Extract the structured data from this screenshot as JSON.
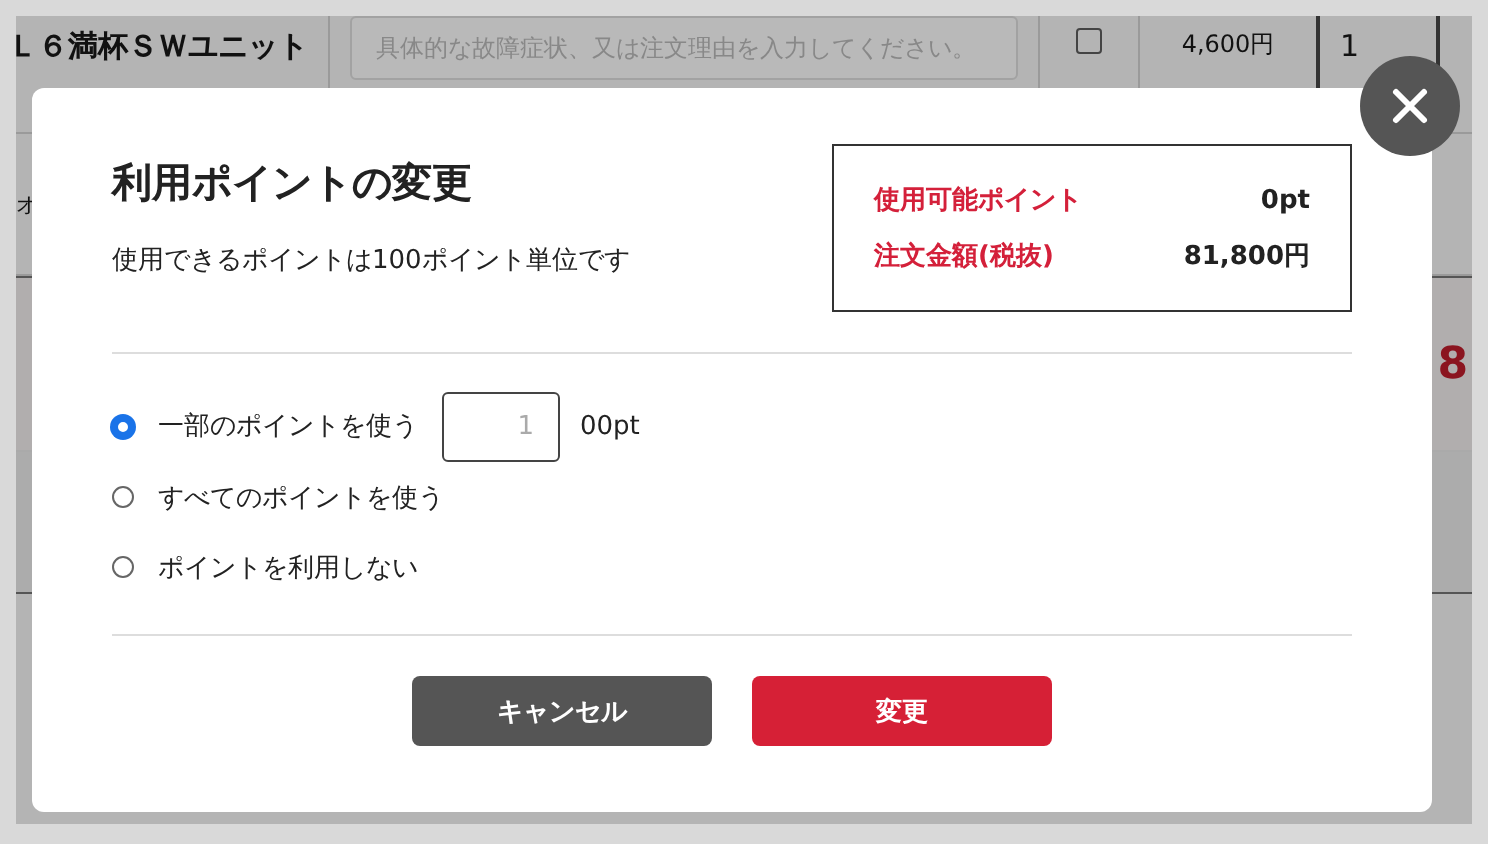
{
  "background_table": {
    "rows": [
      {
        "product": "Ｌ６満杯ＳＷユニット",
        "remark": {
          "placeholder": "具体的な故障症状、又は注文理由を入力してください。"
        },
        "checked": false,
        "price": "4,600円",
        "quantity": "1"
      }
    ],
    "row_fragment": "オ",
    "total_fragment": "8"
  },
  "dialog": {
    "title": "利用ポイントの変更",
    "note": "使用できるポイントは100ポイント単位です",
    "summary": [
      {
        "label": "使用可能ポイント",
        "value": "0pt"
      },
      {
        "label": "注文金額(税抜)",
        "value": "81,800円"
      }
    ],
    "options": [
      {
        "kind": "amount",
        "label": "一部のポイントを使う",
        "selected": true,
        "input": {
          "placeholder": "1"
        },
        "unit": "00pt"
      },
      {
        "kind": "plain",
        "label": "すべてのポイントを使う",
        "selected": false
      },
      {
        "kind": "plain",
        "label": "ポイントを利用しない",
        "selected": false
      }
    ],
    "buttons": [
      {
        "kind": "cancel",
        "label": "キャンセル"
      },
      {
        "kind": "primary",
        "label": "変更"
      }
    ]
  }
}
